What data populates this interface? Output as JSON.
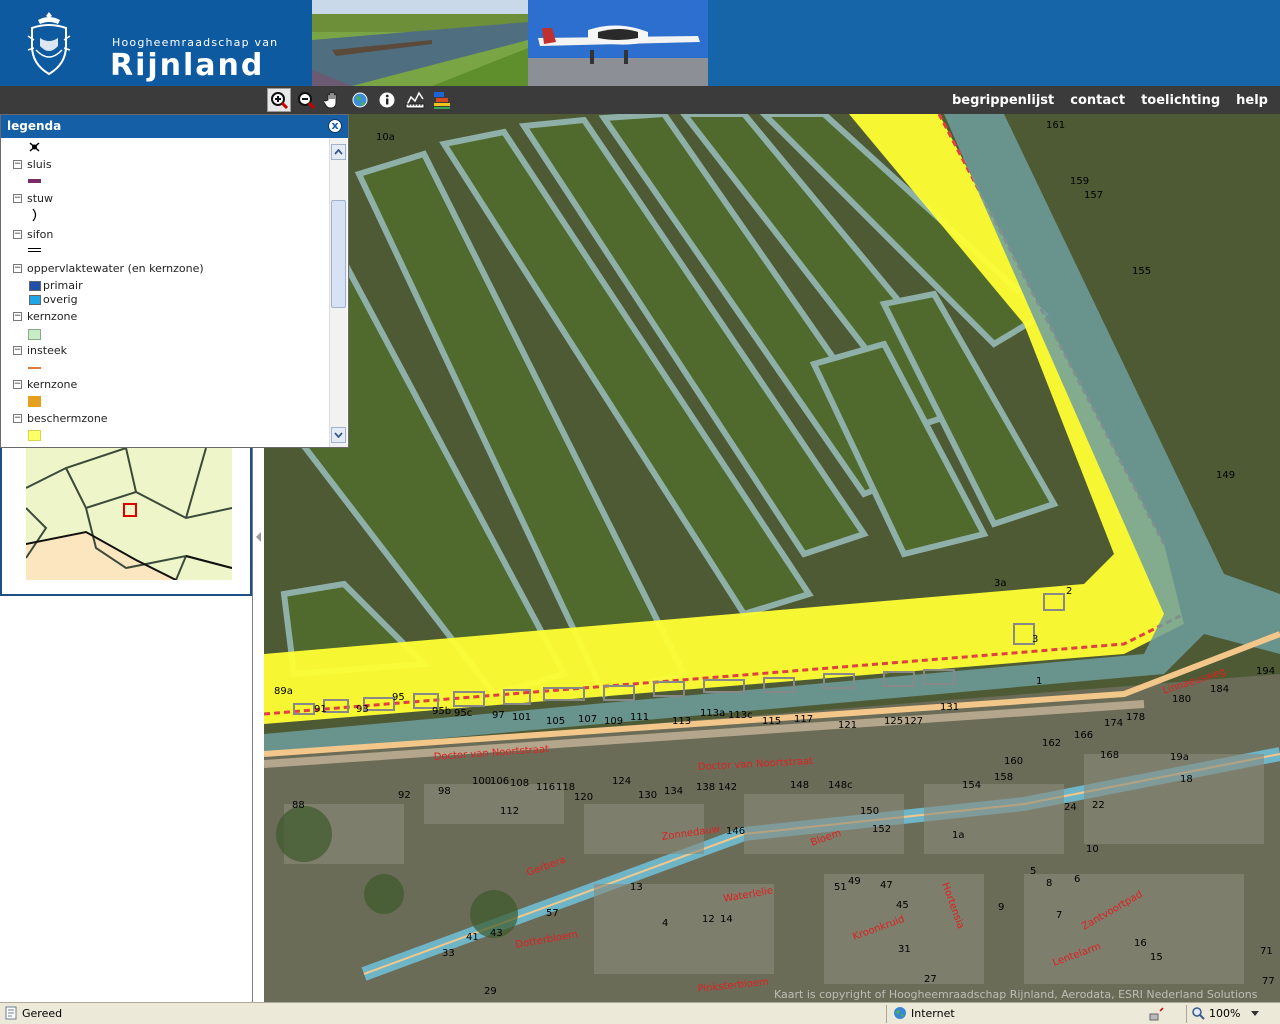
{
  "header": {
    "org_small": "Hoogheemraadschap van",
    "org_big": "Rijnland"
  },
  "toolbar": {
    "tools": [
      "zoom-in-icon",
      "zoom-out-icon",
      "pan-icon",
      "full-extent-icon",
      "info-icon",
      "measure-icon",
      "layers-icon"
    ],
    "nav": {
      "begrippenlijst": "begrippenlijst",
      "contact": "contact",
      "toelichting": "toelichting",
      "help": "help"
    }
  },
  "legend": {
    "title": "legenda",
    "close": "x",
    "items": [
      {
        "label": "sluis"
      },
      {
        "label": "stuw"
      },
      {
        "label": "sifon"
      },
      {
        "label": "oppervlaktewater (en kernzone)"
      },
      {
        "label": "kernzone"
      },
      {
        "label": "insteek"
      },
      {
        "label": "kernzone"
      },
      {
        "label": "beschermzone"
      }
    ],
    "subitems": {
      "primair": "primair",
      "overig": "overig"
    },
    "colors": {
      "sluis": "#7a2b68",
      "primair": "#1f4fa8",
      "overig": "#1ea7e4",
      "kernzone_green": "#c6edc6",
      "insteek": "#e07a3a",
      "kernzone_orange": "#e6a020",
      "beschermzone": "#ffff66"
    }
  },
  "map": {
    "credit": "Kaart is copyright of Hoogheemraadschap Rijnland, Aerodata, ESRI Nederland Solutions",
    "labels": {
      "l10a": "10a",
      "l161": "161",
      "l159": "159",
      "l157": "157",
      "l155": "155",
      "l149": "149",
      "l3a": "3a",
      "l2": "2",
      "l3": "3",
      "l1": "1",
      "l89a": "89a",
      "l91": "91",
      "l93": "93",
      "l95": "95",
      "l95b": "95b",
      "l95c": "95c",
      "l97": "97",
      "l101": "101",
      "l105": "105",
      "l107": "107",
      "l109": "109",
      "l111": "111",
      "l113": "113",
      "l113a": "113a",
      "l113c": "113c",
      "l115": "115",
      "l117": "117",
      "l121": "121",
      "l125": "125",
      "l127": "127",
      "l131": "131",
      "l184": "184",
      "l180": "180",
      "l178": "178",
      "l174": "174",
      "l166": "166",
      "l162": "162",
      "l168": "168",
      "l160": "160",
      "l158": "158",
      "l154": "154",
      "l152": "152",
      "l150": "150",
      "l148": "148",
      "l148c": "148c",
      "l146": "146",
      "l142": "142",
      "l138": "138",
      "l134": "134",
      "l130": "130",
      "l124": "124",
      "l120": "120",
      "l118": "118",
      "l116": "116",
      "l112": "112",
      "l108": "108",
      "l106": "106",
      "l100": "100",
      "l98": "98",
      "l92": "92",
      "l88": "88",
      "l194": "194",
      "l19a": "19a",
      "l18": "18",
      "l24": "24",
      "l22": "22",
      "l1a": "1a",
      "l57": "57",
      "l43": "43",
      "l41": "41",
      "l33": "33",
      "l29": "29",
      "l4": "4",
      "l12": "12",
      "l14": "14",
      "l13": "13",
      "l49": "49",
      "l47": "47",
      "l51": "51",
      "l45": "45",
      "l31": "31",
      "l27": "27",
      "l7": "7",
      "l8": "8",
      "l9": "9",
      "l5": "5",
      "l6": "6",
      "l10": "10",
      "l77": "77",
      "l71": "71",
      "l16": "16",
      "l15": "15"
    },
    "streets": {
      "doctor1": "Doctor van Noortstraat",
      "doctor2": "Doctor van Noortstraat",
      "waterlelie": "Waterlelie",
      "dotterbloem": "Dotterbloem",
      "pinksterbloem": "Pinksterbloem",
      "zonnedauw": "Zonnedauw",
      "bloem": "Bloem",
      "kroonkruid": "Kroonkruid",
      "hortensia": "Hortensia",
      "gerbera": "Gerbera",
      "zantvoortpad": "Zantvoortpad",
      "lentelarm": "Lentelarm",
      "linnaeus": "Linnaeusweg"
    }
  },
  "status": {
    "text": "Gereed",
    "zone": "Internet",
    "zoom": "100%"
  }
}
